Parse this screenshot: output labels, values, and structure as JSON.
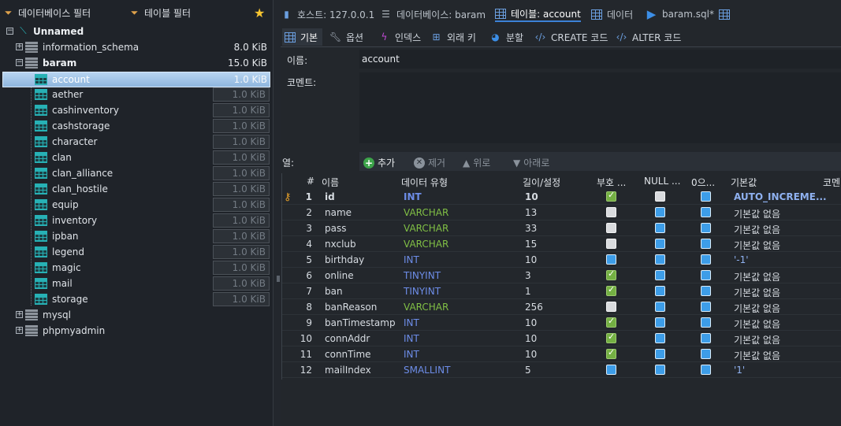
{
  "left": {
    "filter_db": "데이터베이스 필터",
    "filter_tbl": "테이블 필터",
    "tree": [
      {
        "label": "Unnamed",
        "size": ""
      },
      {
        "label": "information_schema",
        "size": "8.0 KiB"
      },
      {
        "label": "baram",
        "size": "15.0 KiB"
      },
      {
        "label": "account",
        "size": "1.0 KiB"
      },
      {
        "label": "aether",
        "size": "1.0 KiB"
      },
      {
        "label": "cashinventory",
        "size": "1.0 KiB"
      },
      {
        "label": "cashstorage",
        "size": "1.0 KiB"
      },
      {
        "label": "character",
        "size": "1.0 KiB"
      },
      {
        "label": "clan",
        "size": "1.0 KiB"
      },
      {
        "label": "clan_alliance",
        "size": "1.0 KiB"
      },
      {
        "label": "clan_hostile",
        "size": "1.0 KiB"
      },
      {
        "label": "equip",
        "size": "1.0 KiB"
      },
      {
        "label": "inventory",
        "size": "1.0 KiB"
      },
      {
        "label": "ipban",
        "size": "1.0 KiB"
      },
      {
        "label": "legend",
        "size": "1.0 KiB"
      },
      {
        "label": "magic",
        "size": "1.0 KiB"
      },
      {
        "label": "mail",
        "size": "1.0 KiB"
      },
      {
        "label": "storage",
        "size": "1.0 KiB"
      },
      {
        "label": "mysql",
        "size": ""
      },
      {
        "label": "phpmyadmin",
        "size": ""
      }
    ]
  },
  "tabs": {
    "host": "호스트: 127.0.0.1",
    "database": "데이터베이스: baram",
    "table": "테이블: account",
    "data": "데이터",
    "query": "baram.sql*"
  },
  "subtabs": {
    "basic": "기본",
    "options": "옵션",
    "indexes": "인덱스",
    "foreign_keys": "외래 키",
    "partitions": "분할",
    "create_code": "CREATE 코드",
    "alter_code": "ALTER 코드"
  },
  "form": {
    "name_label": "이름:",
    "name_value": "account",
    "comment_label": "코멘트:"
  },
  "columns_bar": {
    "label": "열:",
    "add": "추가",
    "remove": "제거",
    "up": "위로",
    "down": "아래로"
  },
  "headers": [
    "#",
    "이름",
    "데이터 유형",
    "길이/설정",
    "부호 ...",
    "NULL ...",
    "0으...",
    "기본값",
    "코멘"
  ],
  "rows": [
    {
      "n": "1",
      "name": "id",
      "type": "INT",
      "len": "10",
      "unsigned": "on",
      "nullable": "off",
      "zerofill": "blue",
      "default": "AUTO_INCREME...",
      "tkind": "int",
      "bold": true
    },
    {
      "n": "2",
      "name": "name",
      "type": "VARCHAR",
      "len": "13",
      "unsigned": "off",
      "nullable": "blue",
      "zerofill": "blue",
      "default": "기본값 없음",
      "tkind": "varchar"
    },
    {
      "n": "3",
      "name": "pass",
      "type": "VARCHAR",
      "len": "33",
      "unsigned": "off",
      "nullable": "blue",
      "zerofill": "blue",
      "default": "기본값 없음",
      "tkind": "varchar"
    },
    {
      "n": "4",
      "name": "nxclub",
      "type": "VARCHAR",
      "len": "15",
      "unsigned": "off",
      "nullable": "blue",
      "zerofill": "blue",
      "default": "기본값 없음",
      "tkind": "varchar"
    },
    {
      "n": "5",
      "name": "birthday",
      "type": "INT",
      "len": "10",
      "unsigned": "blue",
      "nullable": "blue",
      "zerofill": "blue",
      "default": "'-1'",
      "tkind": "int"
    },
    {
      "n": "6",
      "name": "online",
      "type": "TINYINT",
      "len": "3",
      "unsigned": "on",
      "nullable": "blue",
      "zerofill": "blue",
      "default": "기본값 없음",
      "tkind": "tinyint"
    },
    {
      "n": "7",
      "name": "ban",
      "type": "TINYINT",
      "len": "1",
      "unsigned": "on",
      "nullable": "blue",
      "zerofill": "blue",
      "default": "기본값 없음",
      "tkind": "tinyint"
    },
    {
      "n": "8",
      "name": "banReason",
      "type": "VARCHAR",
      "len": "256",
      "unsigned": "off",
      "nullable": "blue",
      "zerofill": "blue",
      "default": "기본값 없음",
      "tkind": "varchar"
    },
    {
      "n": "9",
      "name": "banTimestamp",
      "type": "INT",
      "len": "10",
      "unsigned": "on",
      "nullable": "blue",
      "zerofill": "blue",
      "default": "기본값 없음",
      "tkind": "int"
    },
    {
      "n": "10",
      "name": "connAddr",
      "type": "INT",
      "len": "10",
      "unsigned": "on",
      "nullable": "blue",
      "zerofill": "blue",
      "default": "기본값 없음",
      "tkind": "int"
    },
    {
      "n": "11",
      "name": "connTime",
      "type": "INT",
      "len": "10",
      "unsigned": "on",
      "nullable": "blue",
      "zerofill": "blue",
      "default": "기본값 없음",
      "tkind": "int"
    },
    {
      "n": "12",
      "name": "mailIndex",
      "type": "SMALLINT",
      "len": "5",
      "unsigned": "blue",
      "nullable": "blue",
      "zerofill": "blue",
      "default": "'1'",
      "tkind": "small"
    }
  ]
}
